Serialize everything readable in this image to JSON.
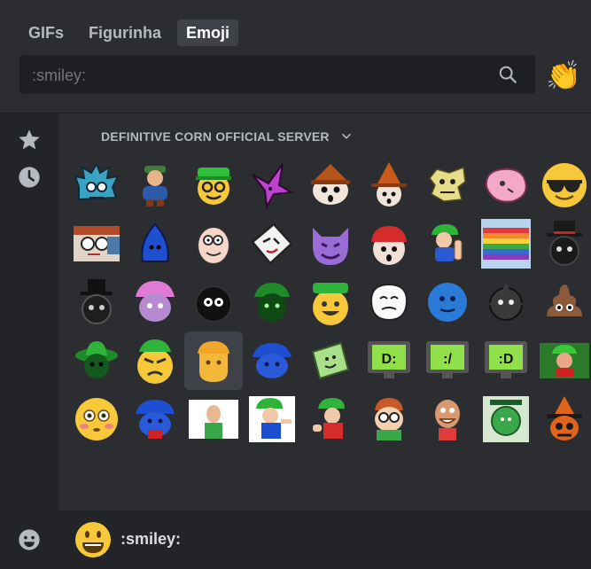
{
  "tabs": [
    {
      "label": "GIFs",
      "active": false
    },
    {
      "label": "Figurinha",
      "active": false
    },
    {
      "label": "Emoji",
      "active": true
    }
  ],
  "search": {
    "value": "",
    "placeholder": ":smiley:"
  },
  "skin_tone_icon": "clapping-hands",
  "sidebar": {
    "items": [
      {
        "icon": "star-icon"
      },
      {
        "icon": "clock-icon"
      }
    ],
    "footer_icon": "smile-icon"
  },
  "section": {
    "title": "DEFINITIVE CORN OFFICIAL SERVER"
  },
  "emojis": [
    {
      "name": "blue-spiky-face"
    },
    {
      "name": "hat-figure"
    },
    {
      "name": "green-cap-glasses"
    },
    {
      "name": "purple-star-face"
    },
    {
      "name": "brown-hat-face"
    },
    {
      "name": "witch-hat-face"
    },
    {
      "name": "crumpled-face"
    },
    {
      "name": "pink-face"
    },
    {
      "name": "sunglasses-face"
    },
    {
      "name": "glasses-man"
    },
    {
      "name": "blue-hood-face"
    },
    {
      "name": "cartoon-dad"
    },
    {
      "name": "tilted-face"
    },
    {
      "name": "purple-devil"
    },
    {
      "name": "red-cap-face"
    },
    {
      "name": "green-cap-finger"
    },
    {
      "name": "rainbow-flag"
    },
    {
      "name": "top-hat-face"
    },
    {
      "name": "dark-top-hat"
    },
    {
      "name": "pink-hat-face"
    },
    {
      "name": "dark-face"
    },
    {
      "name": "green-dark-cap"
    },
    {
      "name": "green-hat-grin"
    },
    {
      "name": "white-face-sketch"
    },
    {
      "name": "blue-ball-face"
    },
    {
      "name": "grey-spiky-ball"
    },
    {
      "name": "poop-face"
    },
    {
      "name": "green-sombrero"
    },
    {
      "name": "angry-green-hat"
    },
    {
      "name": "orange-face"
    },
    {
      "name": "blue-cap-face"
    },
    {
      "name": "green-card"
    },
    {
      "name": "monitor-d-colon"
    },
    {
      "name": "monitor-colon-slash"
    },
    {
      "name": "monitor-colon-d"
    },
    {
      "name": "green-cap-meme"
    },
    {
      "name": "flushed-face"
    },
    {
      "name": "blue-cap-red"
    },
    {
      "name": "bald-teacher"
    },
    {
      "name": "green-cap-pointing"
    },
    {
      "name": "green-cap-wave"
    },
    {
      "name": "glasses-boy"
    },
    {
      "name": "underwear-hero"
    },
    {
      "name": "green-poster"
    },
    {
      "name": "orange-hat-face"
    }
  ],
  "footer": {
    "label": ":smiley:"
  }
}
